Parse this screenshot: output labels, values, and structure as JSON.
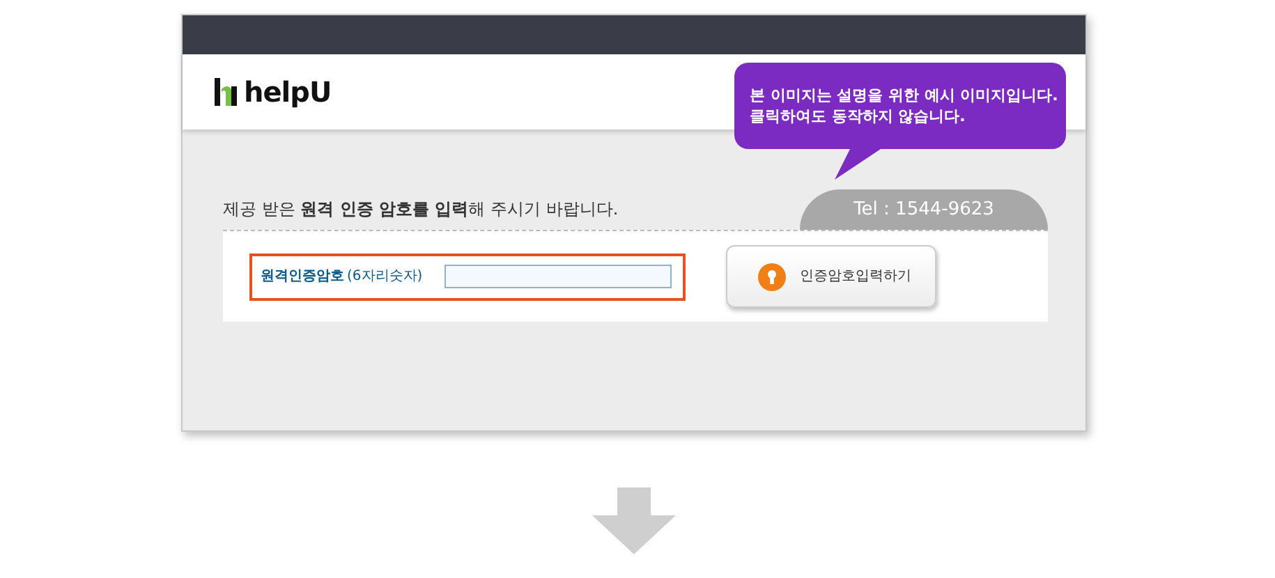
{
  "header": {
    "logo": "helpU"
  },
  "callout": {
    "lines": [
      "본 이미지는 설명을 위한 예시 이미지입니다.",
      "클릭하여도 동작하지 않습니다."
    ]
  },
  "instruction": "제공 받은 **원격 인증 암호를 입력**해 주시기 바랍니다.",
  "phone_tab": "Tel : 1544-9623",
  "form": {
    "label": "원격인증암호",
    "hint": "(6자리숫자)",
    "button": "인증암호입력하기"
  }
}
